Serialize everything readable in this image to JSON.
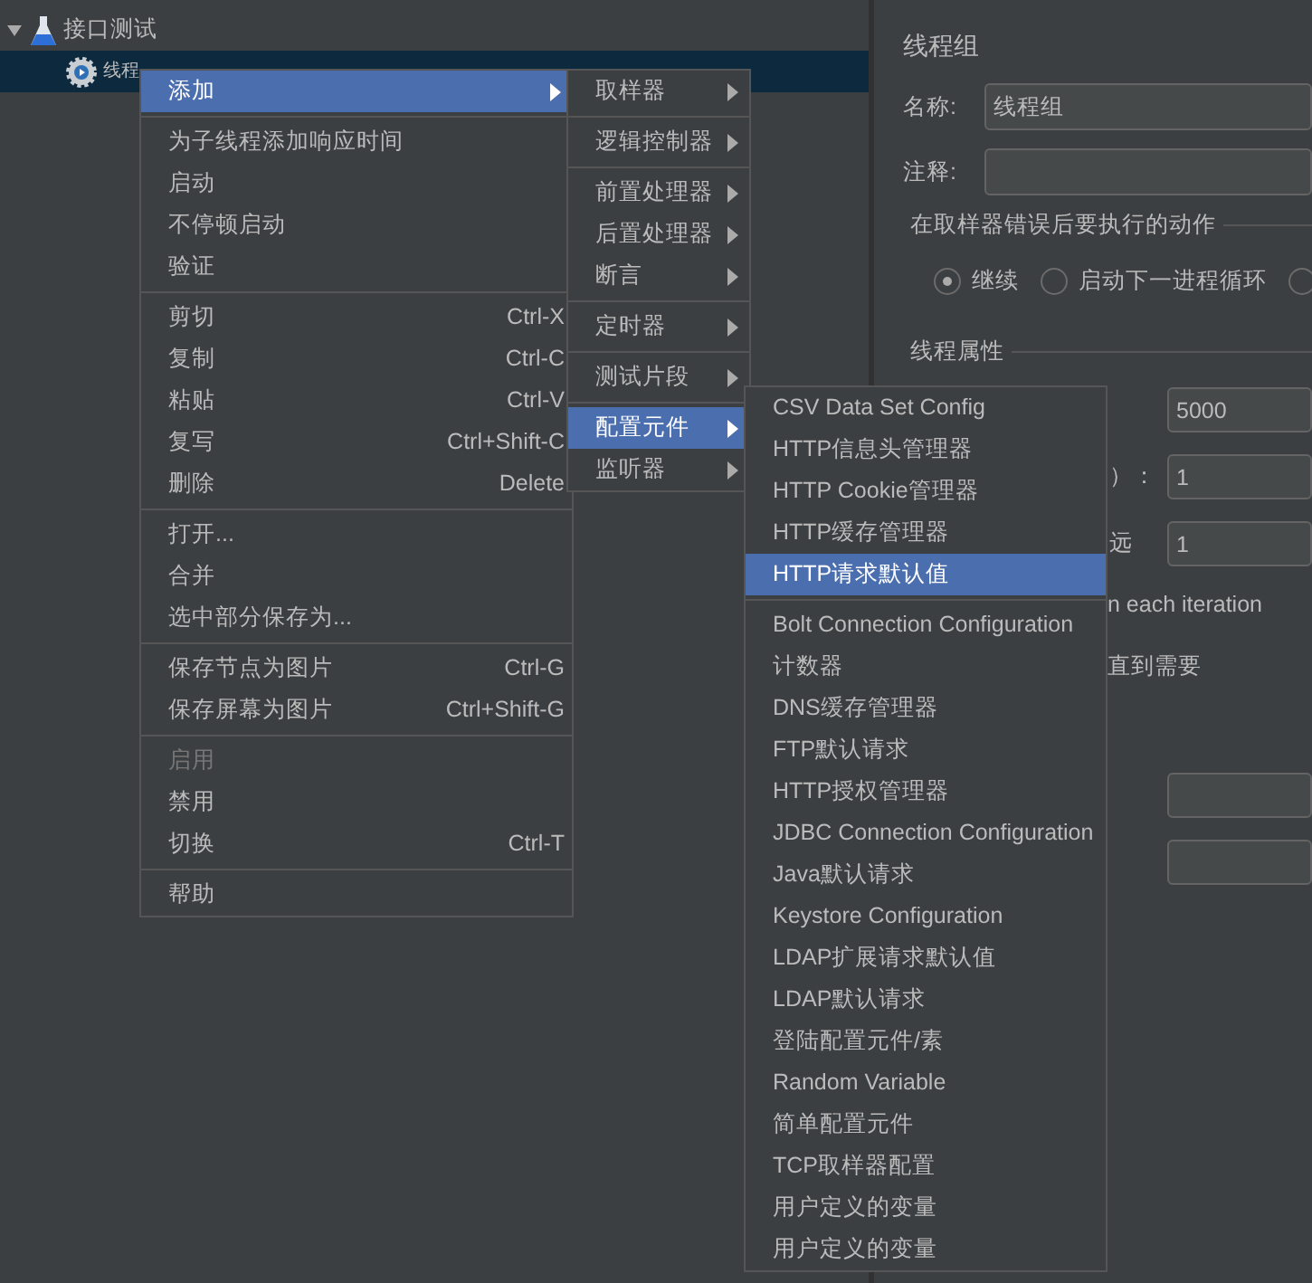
{
  "tree": [
    {
      "label": "接口测试",
      "kind": "test-plan",
      "expanded": true,
      "selected": false
    },
    {
      "label": "线程",
      "kind": "thread-group",
      "selected": true
    }
  ],
  "menus": [
    {
      "groups": [
        [
          {
            "label": "添加",
            "submenu": true,
            "selected": true
          }
        ],
        [
          {
            "label": "为子线程添加响应时间",
            "selected": false
          },
          {
            "label": "启动",
            "selected": false
          },
          {
            "label": "不停顿启动",
            "selected": false
          },
          {
            "label": "验证",
            "selected": false
          }
        ],
        [
          {
            "label": "剪切",
            "shortcut": "Ctrl-X",
            "selected": false
          },
          {
            "label": "复制",
            "shortcut": "Ctrl-C",
            "selected": false
          },
          {
            "label": "粘贴",
            "shortcut": "Ctrl-V",
            "selected": false
          },
          {
            "label": "复写",
            "shortcut": "Ctrl+Shift-C",
            "selected": false
          },
          {
            "label": "删除",
            "shortcut": "Delete",
            "selected": false
          }
        ],
        [
          {
            "label": "打开...",
            "selected": false
          },
          {
            "label": "合并",
            "selected": false
          },
          {
            "label": "选中部分保存为...",
            "selected": false
          }
        ],
        [
          {
            "label": "保存节点为图片",
            "shortcut": "Ctrl-G",
            "selected": false
          },
          {
            "label": "保存屏幕为图片",
            "shortcut": "Ctrl+Shift-G",
            "selected": false
          }
        ],
        [
          {
            "label": "启用",
            "disabled": true,
            "selected": false
          },
          {
            "label": "禁用",
            "disabled": false,
            "selected": false
          },
          {
            "label": "切换",
            "shortcut": "Ctrl-T",
            "disabled": false,
            "selected": false
          }
        ],
        [
          {
            "label": "帮助",
            "selected": false
          }
        ]
      ]
    },
    {
      "groups": [
        [
          {
            "label": "取样器",
            "submenu": true,
            "selected": false
          }
        ],
        [
          {
            "label": "逻辑控制器",
            "submenu": true,
            "selected": false
          }
        ],
        [
          {
            "label": "前置处理器",
            "submenu": true,
            "selected": false
          },
          {
            "label": "后置处理器",
            "submenu": true,
            "selected": false
          },
          {
            "label": "断言",
            "submenu": true,
            "selected": false
          }
        ],
        [
          {
            "label": "定时器",
            "submenu": true,
            "selected": false
          }
        ],
        [
          {
            "label": "测试片段",
            "submenu": true,
            "selected": false
          }
        ],
        [
          {
            "label": "配置元件",
            "submenu": true,
            "selected": true
          },
          {
            "label": "监听器",
            "submenu": true,
            "selected": false
          }
        ]
      ]
    },
    {
      "groups": [
        [
          {
            "label": "CSV Data Set Config",
            "selected": false
          },
          {
            "label": "HTTP信息头管理器",
            "selected": false
          },
          {
            "label": "HTTP Cookie管理器",
            "selected": false
          },
          {
            "label": "HTTP缓存管理器",
            "selected": false
          },
          {
            "label": "HTTP请求默认值",
            "selected": true
          }
        ],
        [
          {
            "label": "Bolt Connection Configuration",
            "selected": false
          },
          {
            "label": "计数器",
            "selected": false
          },
          {
            "label": "DNS缓存管理器",
            "selected": false
          },
          {
            "label": "FTP默认请求",
            "selected": false
          },
          {
            "label": "HTTP授权管理器",
            "selected": false
          },
          {
            "label": "JDBC Connection Configuration",
            "selected": false
          },
          {
            "label": "Java默认请求",
            "selected": false
          },
          {
            "label": "Keystore Configuration",
            "selected": false
          },
          {
            "label": "LDAP扩展请求默认值",
            "selected": false
          },
          {
            "label": "LDAP默认请求",
            "selected": false
          },
          {
            "label": "登陆配置元件/素",
            "selected": false
          },
          {
            "label": "Random Variable",
            "selected": false
          },
          {
            "label": "简单配置元件",
            "selected": false
          },
          {
            "label": "TCP取样器配置",
            "selected": false
          },
          {
            "label": "用户定义的变量",
            "selected": false
          },
          {
            "label": "用户定义的变量",
            "selected": false
          }
        ]
      ]
    }
  ],
  "panel": {
    "title": "线程组",
    "name_label": "名称:",
    "name_value": "线程组",
    "comment_label": "注释:",
    "error_section": "在取样器错误后要执行的动作",
    "radios": [
      {
        "label": "继续",
        "selected": true
      },
      {
        "label": "启动下一进程循环",
        "selected": false
      },
      {
        "selected": false
      }
    ],
    "thread_section": "线程属性",
    "rows": [
      {
        "value": "5000"
      },
      {
        "label": "）：",
        "value": "1"
      },
      {
        "label": "远",
        "value": "1"
      }
    ],
    "texts": [
      "n each iteration",
      "直到需要"
    ]
  }
}
